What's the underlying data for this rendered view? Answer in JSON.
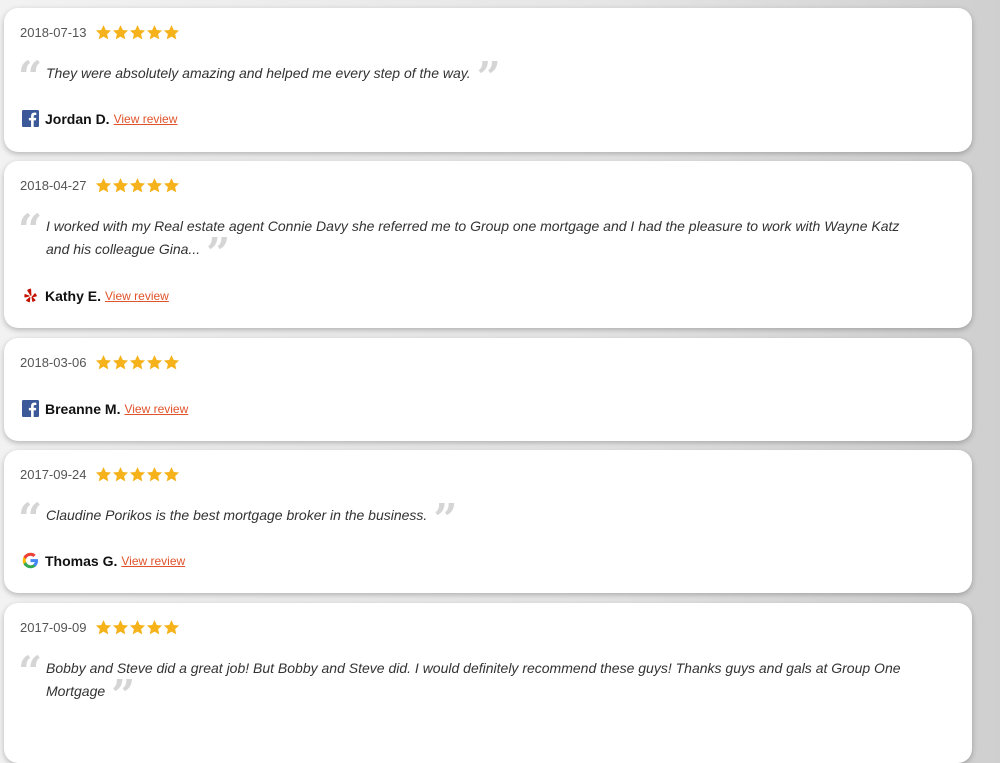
{
  "reviews": [
    {
      "date": "2018-07-13",
      "rating": 5,
      "text": "They were absolutely amazing and helped me every step of the way.",
      "author": "Jordan D.",
      "source": "facebook-icon",
      "link": "View review"
    },
    {
      "date": "2018-04-27",
      "rating": 5,
      "text": "I worked with my Real estate agent Connie Davy she referred me to Group one mortgage and I had the pleasure to work with Wayne Katz and his colleague Gina...",
      "author": "Kathy E.",
      "source": "yelp-icon",
      "link": "View review"
    },
    {
      "date": "2018-03-06",
      "rating": 5,
      "text": "",
      "author": "Breanne M.",
      "source": "facebook-icon",
      "link": "View review"
    },
    {
      "date": "2017-09-24",
      "rating": 5,
      "text": "Claudine Porikos is the best mortgage broker in the business.",
      "author": "Thomas G.",
      "source": "google-icon",
      "link": "View review"
    },
    {
      "date": "2017-09-09",
      "rating": 5,
      "text": "Bobby and Steve did a great job! But Bobby and Steve did. I would definitely recommend these guys! Thanks guys and gals at Group One Mortgage",
      "author": "",
      "source": "",
      "link": ""
    }
  ],
  "colors": {
    "star": "#f5b21b",
    "link": "#e0532b",
    "facebook": "#3b5998",
    "yelp": "#c41200"
  }
}
